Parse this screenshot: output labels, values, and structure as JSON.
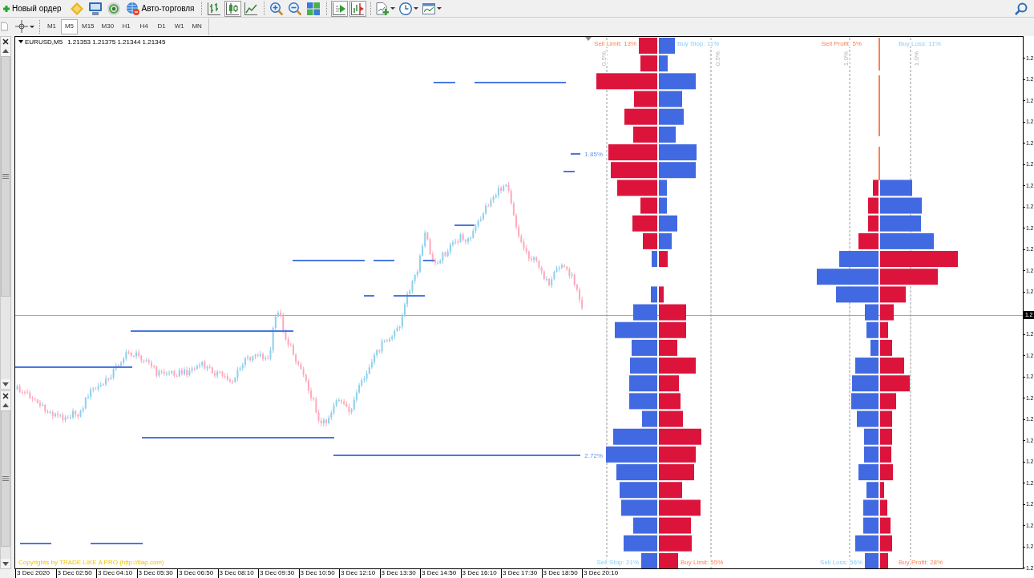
{
  "toolbar": {
    "new_order": {
      "label": "Новый ордер"
    },
    "auto_trading": {
      "label": "Авто-торговля"
    },
    "chart_types": [
      {
        "kind": "bars",
        "selected": false
      },
      {
        "kind": "candles",
        "selected": true
      },
      {
        "kind": "line",
        "selected": false
      }
    ],
    "view_toggles": [
      {
        "kind": "autoscroll",
        "on": true
      },
      {
        "kind": "chart_shift",
        "on": true
      }
    ]
  },
  "timeframes": [
    {
      "label": "M1",
      "selected": false
    },
    {
      "label": "M5",
      "selected": true
    },
    {
      "label": "M15",
      "selected": false
    },
    {
      "label": "M30",
      "selected": false
    },
    {
      "label": "H1",
      "selected": false
    },
    {
      "label": "H4",
      "selected": false
    },
    {
      "label": "D1",
      "selected": false
    },
    {
      "label": "W1",
      "selected": false
    },
    {
      "label": "MN",
      "selected": false
    }
  ],
  "chart": {
    "symbol": "EURUSD,M5",
    "ohlc": "1.21353 1.21375 1.21344 1.21345",
    "level_labels": [
      "1.85%",
      "2.72%"
    ],
    "order_book": {
      "top_left": "Sell Limit: 13%",
      "top_right": "Buy Stop: 11%",
      "bottom_left": "Sell Stop: 21%",
      "bottom_right": "Buy Limit: 55%",
      "guides": [
        "0.5%",
        "0.5%"
      ]
    },
    "position_book": {
      "top_left": "Sell Profit: 5%",
      "top_right": "Buy Loss: 11%",
      "bottom_left": "Sell Loss: 56%",
      "bottom_right": "Buy Profit: 28%",
      "guides": [
        "1.0%",
        "1.0%"
      ]
    },
    "copyright": "Copyrights by TRADE LIKE A PRO (http://tlap.com)"
  },
  "price_axis": {
    "labels": [
      "1.2",
      "1.2",
      "1.2",
      "1.2",
      "1.2",
      "1.2",
      "1.2",
      "1.2",
      "1.2",
      "1.2",
      "1.2",
      "1.2",
      "1.2",
      "1.2",
      "1.2",
      "1.2",
      "1.2",
      "1.2",
      "1.2",
      "1.2",
      "1.2",
      "1.2",
      "1.2",
      "1.2"
    ],
    "current_price": "1.2"
  },
  "time_axis": {
    "labels": [
      "3 Dec 2020",
      "3 Dec 02:50",
      "3 Dec 04:10",
      "3 Dec 05:30",
      "3 Dec 06:50",
      "3 Dec 08:10",
      "3 Dec 09:30",
      "3 Dec 10:50",
      "3 Dec 12:10",
      "3 Dec 13:30",
      "3 Dec 14:50",
      "3 Dec 16:10",
      "3 Dec 17:30",
      "3 Dec 18:50",
      "3 Dec 20:10"
    ]
  }
}
